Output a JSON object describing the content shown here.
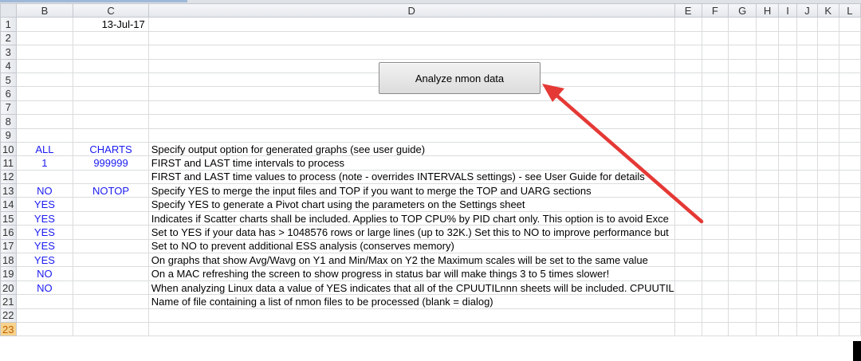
{
  "columns": [
    "B",
    "C",
    "D",
    "E",
    "F",
    "G",
    "H",
    "I",
    "J",
    "K",
    "L"
  ],
  "button_label": "Analyze nmon data",
  "accent": "#1b1bf0",
  "arrow_color": "#e53935",
  "rows": [
    {
      "n": "1",
      "b": "",
      "c": "13-Jul-17",
      "d": ""
    },
    {
      "n": "2",
      "b": "",
      "c": "",
      "d": ""
    },
    {
      "n": "3",
      "b": "",
      "c": "",
      "d": ""
    },
    {
      "n": "4",
      "b": "",
      "c": "",
      "d": ""
    },
    {
      "n": "5",
      "b": "",
      "c": "",
      "d": ""
    },
    {
      "n": "6",
      "b": "",
      "c": "",
      "d": ""
    },
    {
      "n": "7",
      "b": "",
      "c": "",
      "d": ""
    },
    {
      "n": "8",
      "b": "",
      "c": "",
      "d": ""
    },
    {
      "n": "9",
      "b": "",
      "c": "",
      "d": ""
    },
    {
      "n": "10",
      "b": "ALL",
      "c": "CHARTS",
      "d": "Specify output option for generated graphs (see user guide)"
    },
    {
      "n": "11",
      "b": "1",
      "c": "999999",
      "d": "FIRST and LAST time intervals to process"
    },
    {
      "n": "12",
      "b": "",
      "c": "",
      "d": "FIRST and LAST time values to process (note - overrides INTERVALS settings) - see User Guide for details"
    },
    {
      "n": "13",
      "b": "NO",
      "c": "NOTOP",
      "d": "Specify YES to merge the input files and TOP if you want to merge the TOP and UARG sections"
    },
    {
      "n": "14",
      "b": "YES",
      "c": "",
      "d": "Specify YES to generate a Pivot chart using the parameters on the Settings sheet"
    },
    {
      "n": "15",
      "b": "YES",
      "c": "",
      "d": "Indicates if Scatter charts shall be included.  Applies to TOP CPU% by PID chart only.  This option is to avoid Exce"
    },
    {
      "n": "16",
      "b": "YES",
      "c": "",
      "d": "Set to YES if your data has > 1048576 rows or large lines (up to 32K.)  Set this to NO to improve performance but"
    },
    {
      "n": "17",
      "b": "YES",
      "c": "",
      "d": "Set to NO to prevent additional ESS analysis (conserves memory)"
    },
    {
      "n": "18",
      "b": "YES",
      "c": "",
      "d": "On graphs that show Avg/Wavg on Y1 and Min/Max on Y2 the Maximum scales will be set to the same value"
    },
    {
      "n": "19",
      "b": "NO",
      "c": "",
      "d": "On a MAC refreshing the screen to show progress in status bar will make things 3 to 5 times slower!"
    },
    {
      "n": "20",
      "b": "NO",
      "c": "",
      "d": "When analyzing Linux data a value of YES indicates that all of the CPUUTILnnn sheets will be included.  CPUUTIL"
    },
    {
      "n": "21",
      "b": "",
      "c": "",
      "d": "Name of file containing a list of nmon files to be processed (blank = dialog)"
    },
    {
      "n": "22",
      "b": "",
      "c": "",
      "d": ""
    },
    {
      "n": "23",
      "b": "",
      "c": "",
      "d": ""
    }
  ]
}
